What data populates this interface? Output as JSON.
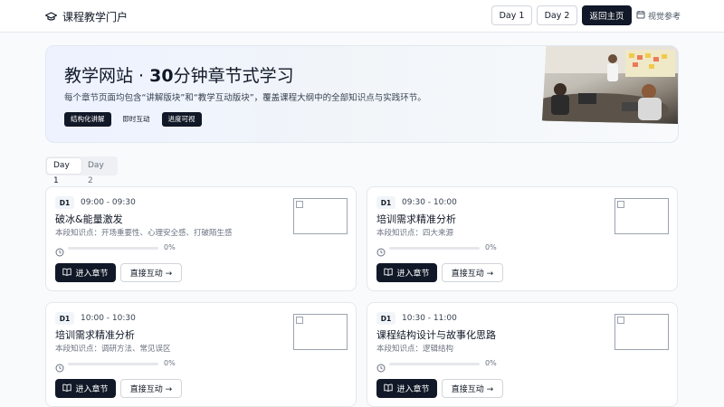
{
  "header": {
    "brand": "课程教学门户",
    "day1": "Day 1",
    "day2": "Day 2",
    "home": "返回主页",
    "visual_ref": "视觉参考"
  },
  "hero": {
    "title_prefix": "教学网站 · ",
    "title_bold": "30",
    "title_suffix": "分钟章节式学习",
    "subtitle": "每个章节页面均包含“讲解版块”和“教学互动版块”，覆盖课程大纲中的全部知识点与实践环节。",
    "tags": [
      "结构化讲解",
      "即时互动",
      "进度可视"
    ]
  },
  "tabs": [
    "Day 1",
    "Day 2"
  ],
  "card_labels": {
    "enter": "进入章节",
    "direct": "直接互动 →"
  },
  "cards": [
    {
      "day": "D1",
      "time": "09:00 - 09:30",
      "title": "破冰&能量激发",
      "desc": "本段知识点：开场重要性、心理安全感、打破陌生感",
      "progress": 0,
      "progress_label": "0%"
    },
    {
      "day": "D1",
      "time": "09:30 - 10:00",
      "title": "培训需求精准分析",
      "desc": "本段知识点：四大来源",
      "progress": 0,
      "progress_label": "0%"
    },
    {
      "day": "D1",
      "time": "10:00 - 10:30",
      "title": "培训需求精准分析",
      "desc": "本段知识点：调研方法、常见误区",
      "progress": 0,
      "progress_label": "0%"
    },
    {
      "day": "D1",
      "time": "10:30 - 11:00",
      "title": "课程结构设计与故事化思路",
      "desc": "本段知识点：逻辑结构",
      "progress": 0,
      "progress_label": "0%"
    }
  ]
}
